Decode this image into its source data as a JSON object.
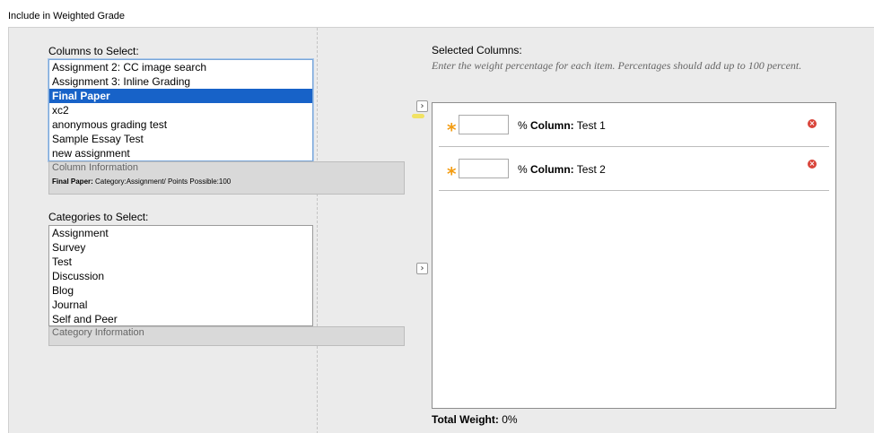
{
  "page_title": "Include in Weighted Grade",
  "columns": {
    "label": "Columns to Select:",
    "options": [
      "Assignment 2: CC image search",
      "Assignment 3: Inline Grading",
      "Final Paper",
      "xc2",
      "anonymous grading test",
      "Sample Essay Test",
      "new assignment"
    ],
    "selected": "Final Paper",
    "info_title": "Column Information",
    "info_name": "Final Paper:",
    "info_detail": " Category:Assignment/ Points Possible:100"
  },
  "categories": {
    "label": "Categories to Select:",
    "options": [
      "Assignment",
      "Survey",
      "Test",
      "Discussion",
      "Blog",
      "Journal",
      "Self and Peer"
    ],
    "info_title": "Category Information"
  },
  "add_buttons": {
    "columns": "›",
    "categories": "›"
  },
  "selected": {
    "title": "Selected Columns:",
    "instruction": "Enter the weight percentage for each item. Percentages should add up to 100 percent.",
    "rows": [
      {
        "required": "*",
        "value": "",
        "unit": "% ",
        "kind": "Column:",
        "name": " Test 1",
        "remove": "×"
      },
      {
        "required": "*",
        "value": "",
        "unit": "% ",
        "kind": "Column:",
        "name": " Test 2",
        "remove": "×"
      }
    ]
  },
  "total": {
    "label": "Total Weight:",
    "value": " 0%"
  },
  "colors": {
    "selection": "#1762c8",
    "required_star": "#f39c12",
    "remove": "#d9443a",
    "panel": "#ebebeb"
  }
}
